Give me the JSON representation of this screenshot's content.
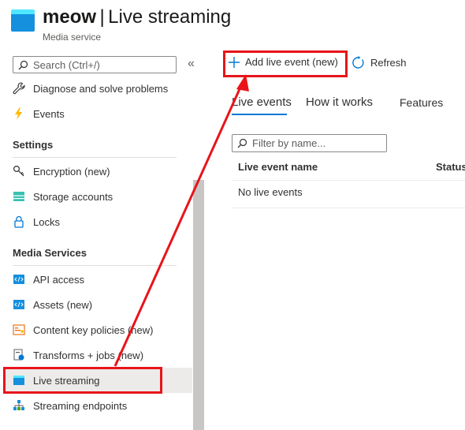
{
  "header": {
    "title_name": "meow",
    "title_separator": "|",
    "title_page": "Live streaming",
    "subtitle": "Media service",
    "icon": "media-service-icon"
  },
  "sidebar": {
    "search_placeholder": "Search (Ctrl+/)",
    "collapse_glyph": "«",
    "items_top": [
      {
        "label": "Diagnose and solve problems",
        "icon": "wrench-icon"
      },
      {
        "label": "Events",
        "icon": "lightning-icon"
      }
    ],
    "settings_header": "Settings",
    "settings_items": [
      {
        "label": "Encryption (new)",
        "icon": "key-icon"
      },
      {
        "label": "Storage accounts",
        "icon": "storage-icon"
      },
      {
        "label": "Locks",
        "icon": "lock-icon"
      }
    ],
    "media_header": "Media Services",
    "media_items": [
      {
        "label": "API access",
        "icon": "api-icon"
      },
      {
        "label": "Assets (new)",
        "icon": "assets-icon"
      },
      {
        "label": "Content key policies (new)",
        "icon": "content-key-icon"
      },
      {
        "label": "Transforms + jobs (new)",
        "icon": "transforms-icon"
      },
      {
        "label": "Live streaming",
        "icon": "live-streaming-icon",
        "active": true
      },
      {
        "label": "Streaming endpoints",
        "icon": "streaming-endpoints-icon"
      }
    ]
  },
  "toolbar": {
    "add_label": "Add live event (new)",
    "refresh_label": "Refresh"
  },
  "tabs": [
    {
      "label": "Live events",
      "selected": true
    },
    {
      "label": "How it works",
      "selected": false
    },
    {
      "label": "Features",
      "selected": false
    }
  ],
  "filter": {
    "placeholder": "Filter by name..."
  },
  "table": {
    "columns": [
      "Live event name",
      "Status"
    ],
    "empty_message": "No live events"
  },
  "colors": {
    "accent": "#0078d4",
    "annotation": "#e8141a",
    "active_bg": "#edebe9"
  }
}
